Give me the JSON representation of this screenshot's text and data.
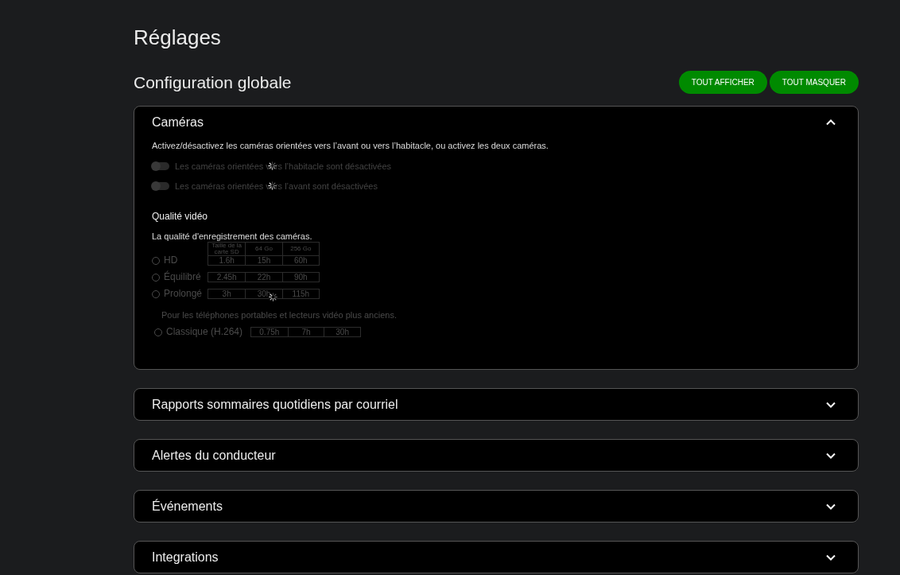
{
  "page_title": "Réglages",
  "section_title": "Configuration globale",
  "actions": [
    {
      "label": "TOUT AFFICHER"
    },
    {
      "label": "TOUT MASQUER"
    }
  ],
  "panels": [
    {
      "title": "Caméras",
      "expanded": true,
      "loading": true,
      "description": "Activez/désactivez les caméras orientées vers l’avant ou vers l’habitacle, ou activez les deux caméras.",
      "toggles": [
        {
          "label": "Les caméras orientées vers l’habitacle sont désactivées",
          "on": false,
          "disabled": true
        },
        {
          "label": "Les caméras orientées vers l’avant sont désactivées",
          "on": false,
          "disabled": true
        }
      ],
      "video_quality": {
        "title": "Qualité vidéo",
        "description": "La qualité d'enregistrement des caméras.",
        "disabled": true,
        "columns": [
          "Taille de la carte SD",
          "64 Go",
          "256 Go"
        ],
        "options": [
          {
            "label": "HD",
            "selected": false,
            "values": [
              "1.6h",
              "15h",
              "60h"
            ]
          },
          {
            "label": "Équilibré",
            "selected": false,
            "values": [
              "2.45h",
              "22h",
              "90h"
            ]
          },
          {
            "label": "Prolongé",
            "selected": false,
            "values": [
              "3h",
              "30h",
              "115h"
            ]
          }
        ],
        "legacy_note": "Pour les téléphones portables et lecteurs vidéo plus anciens.",
        "legacy_options": [
          {
            "label": "Classique (H.264)",
            "selected": false,
            "values": [
              "0.75h",
              "7h",
              "30h"
            ]
          }
        ]
      }
    },
    {
      "title": "Rapports sommaires quotidiens par courriel",
      "expanded": false
    },
    {
      "title": "Alertes du conducteur",
      "expanded": false
    },
    {
      "title": "Événements",
      "expanded": false
    },
    {
      "title": "Integrations",
      "expanded": false
    }
  ]
}
